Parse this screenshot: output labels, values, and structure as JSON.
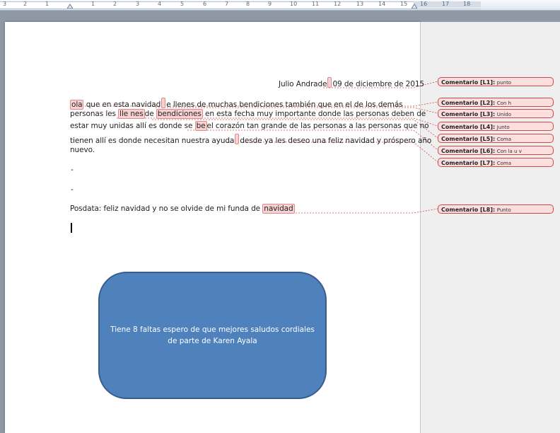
{
  "ruler": {
    "numbers": [
      "3",
      "2",
      "1",
      "1",
      "2",
      "3",
      "4",
      "5",
      "6",
      "7",
      "8",
      "9",
      "10",
      "11",
      "12",
      "13",
      "14",
      "15",
      "16",
      "17",
      "18"
    ]
  },
  "document": {
    "line1": {
      "before": "Julio Andrade",
      "after": "09 de diciembre de 2015"
    },
    "para1": {
      "l1": {
        "w1": "ola",
        "t1": "que en esta navidad",
        "t2": "e llenes de muchas bendiciones también que en el de los demás"
      },
      "l2": {
        "t1": "personas les ",
        "w1": "lle nes",
        "t2": "de ",
        "w2": "bendiciones",
        "t3": " en esta fecha muy importante donde las personas deben de"
      },
      "l3": {
        "t1": "estar muy unidas allí es donde se ",
        "w1": "be",
        "t2": "el corazón tan grande de las personas a las personas que no"
      },
      "l4": {
        "t1": "tienen allí es donde necesitan nuestra ayuda",
        "t2": "desde ya les deseo una feliz navidad y próspero año"
      },
      "l5": "nuevo."
    },
    "dash1": "-",
    "dash2": "-",
    "posdata": {
      "t1": "Posdata: feliz navidad y no se olvide de mi funda de ",
      "w1": "navidad"
    }
  },
  "comments": [
    {
      "label": "Comentario [L1]:",
      "text": "punto"
    },
    {
      "label": "Comentario [L2]:",
      "text": "Con h"
    },
    {
      "label": "Comentario [L3]:",
      "text": "Unido"
    },
    {
      "label": "Comentario [L4]:",
      "text": "Junto"
    },
    {
      "label": "Comentario [L5]:",
      "text": "Coma"
    },
    {
      "label": "Comentario [L6]:",
      "text": "Con la u v"
    },
    {
      "label": "Comentario [L7]:",
      "text": "Coma"
    },
    {
      "label": "Comentario [L8]:",
      "text": "Punto"
    }
  ],
  "shape": {
    "text": "Tiene 8 faltas espero de que mejores saludos cordiales de parte de Karen Ayala"
  },
  "colors": {
    "comment_line": "#d14848",
    "comment_fill": "#fbdede",
    "shape_fill": "#4f81bd",
    "shape_border": "#385d8a"
  }
}
